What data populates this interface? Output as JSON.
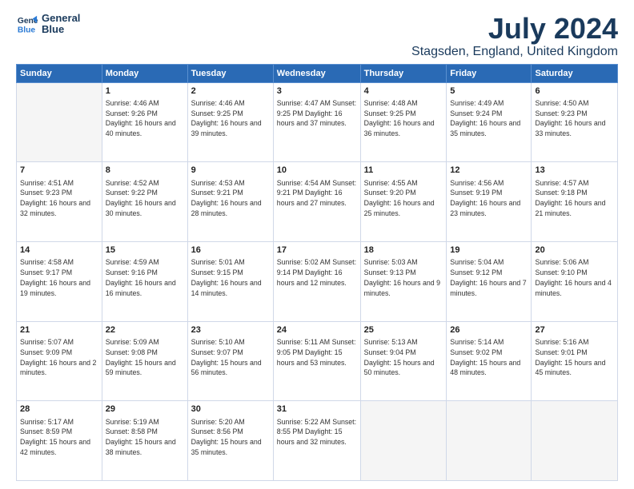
{
  "header": {
    "logo_line1": "General",
    "logo_line2": "Blue",
    "title": "July 2024",
    "subtitle": "Stagsden, England, United Kingdom"
  },
  "days_of_week": [
    "Sunday",
    "Monday",
    "Tuesday",
    "Wednesday",
    "Thursday",
    "Friday",
    "Saturday"
  ],
  "weeks": [
    [
      {
        "day": "",
        "info": ""
      },
      {
        "day": "1",
        "info": "Sunrise: 4:46 AM\nSunset: 9:26 PM\nDaylight: 16 hours\nand 40 minutes."
      },
      {
        "day": "2",
        "info": "Sunrise: 4:46 AM\nSunset: 9:25 PM\nDaylight: 16 hours\nand 39 minutes."
      },
      {
        "day": "3",
        "info": "Sunrise: 4:47 AM\nSunset: 9:25 PM\nDaylight: 16 hours\nand 37 minutes."
      },
      {
        "day": "4",
        "info": "Sunrise: 4:48 AM\nSunset: 9:25 PM\nDaylight: 16 hours\nand 36 minutes."
      },
      {
        "day": "5",
        "info": "Sunrise: 4:49 AM\nSunset: 9:24 PM\nDaylight: 16 hours\nand 35 minutes."
      },
      {
        "day": "6",
        "info": "Sunrise: 4:50 AM\nSunset: 9:23 PM\nDaylight: 16 hours\nand 33 minutes."
      }
    ],
    [
      {
        "day": "7",
        "info": "Sunrise: 4:51 AM\nSunset: 9:23 PM\nDaylight: 16 hours\nand 32 minutes."
      },
      {
        "day": "8",
        "info": "Sunrise: 4:52 AM\nSunset: 9:22 PM\nDaylight: 16 hours\nand 30 minutes."
      },
      {
        "day": "9",
        "info": "Sunrise: 4:53 AM\nSunset: 9:21 PM\nDaylight: 16 hours\nand 28 minutes."
      },
      {
        "day": "10",
        "info": "Sunrise: 4:54 AM\nSunset: 9:21 PM\nDaylight: 16 hours\nand 27 minutes."
      },
      {
        "day": "11",
        "info": "Sunrise: 4:55 AM\nSunset: 9:20 PM\nDaylight: 16 hours\nand 25 minutes."
      },
      {
        "day": "12",
        "info": "Sunrise: 4:56 AM\nSunset: 9:19 PM\nDaylight: 16 hours\nand 23 minutes."
      },
      {
        "day": "13",
        "info": "Sunrise: 4:57 AM\nSunset: 9:18 PM\nDaylight: 16 hours\nand 21 minutes."
      }
    ],
    [
      {
        "day": "14",
        "info": "Sunrise: 4:58 AM\nSunset: 9:17 PM\nDaylight: 16 hours\nand 19 minutes."
      },
      {
        "day": "15",
        "info": "Sunrise: 4:59 AM\nSunset: 9:16 PM\nDaylight: 16 hours\nand 16 minutes."
      },
      {
        "day": "16",
        "info": "Sunrise: 5:01 AM\nSunset: 9:15 PM\nDaylight: 16 hours\nand 14 minutes."
      },
      {
        "day": "17",
        "info": "Sunrise: 5:02 AM\nSunset: 9:14 PM\nDaylight: 16 hours\nand 12 minutes."
      },
      {
        "day": "18",
        "info": "Sunrise: 5:03 AM\nSunset: 9:13 PM\nDaylight: 16 hours\nand 9 minutes."
      },
      {
        "day": "19",
        "info": "Sunrise: 5:04 AM\nSunset: 9:12 PM\nDaylight: 16 hours\nand 7 minutes."
      },
      {
        "day": "20",
        "info": "Sunrise: 5:06 AM\nSunset: 9:10 PM\nDaylight: 16 hours\nand 4 minutes."
      }
    ],
    [
      {
        "day": "21",
        "info": "Sunrise: 5:07 AM\nSunset: 9:09 PM\nDaylight: 16 hours\nand 2 minutes."
      },
      {
        "day": "22",
        "info": "Sunrise: 5:09 AM\nSunset: 9:08 PM\nDaylight: 15 hours\nand 59 minutes."
      },
      {
        "day": "23",
        "info": "Sunrise: 5:10 AM\nSunset: 9:07 PM\nDaylight: 15 hours\nand 56 minutes."
      },
      {
        "day": "24",
        "info": "Sunrise: 5:11 AM\nSunset: 9:05 PM\nDaylight: 15 hours\nand 53 minutes."
      },
      {
        "day": "25",
        "info": "Sunrise: 5:13 AM\nSunset: 9:04 PM\nDaylight: 15 hours\nand 50 minutes."
      },
      {
        "day": "26",
        "info": "Sunrise: 5:14 AM\nSunset: 9:02 PM\nDaylight: 15 hours\nand 48 minutes."
      },
      {
        "day": "27",
        "info": "Sunrise: 5:16 AM\nSunset: 9:01 PM\nDaylight: 15 hours\nand 45 minutes."
      }
    ],
    [
      {
        "day": "28",
        "info": "Sunrise: 5:17 AM\nSunset: 8:59 PM\nDaylight: 15 hours\nand 42 minutes."
      },
      {
        "day": "29",
        "info": "Sunrise: 5:19 AM\nSunset: 8:58 PM\nDaylight: 15 hours\nand 38 minutes."
      },
      {
        "day": "30",
        "info": "Sunrise: 5:20 AM\nSunset: 8:56 PM\nDaylight: 15 hours\nand 35 minutes."
      },
      {
        "day": "31",
        "info": "Sunrise: 5:22 AM\nSunset: 8:55 PM\nDaylight: 15 hours\nand 32 minutes."
      },
      {
        "day": "",
        "info": ""
      },
      {
        "day": "",
        "info": ""
      },
      {
        "day": "",
        "info": ""
      }
    ]
  ]
}
